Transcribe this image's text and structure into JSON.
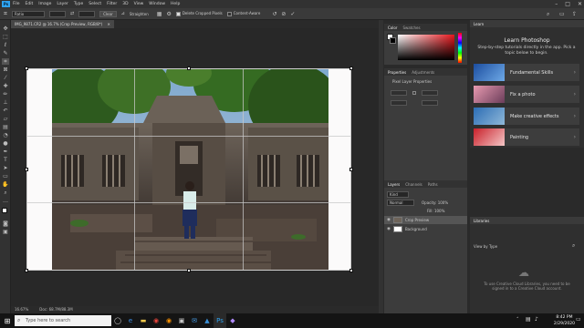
{
  "menubar": {
    "logo": "Ps",
    "items": [
      "File",
      "Edit",
      "Image",
      "Layer",
      "Type",
      "Select",
      "Filter",
      "3D",
      "View",
      "Window",
      "Help"
    ]
  },
  "options": {
    "ratio_value": "Ratio",
    "clear_label": "Clear",
    "straighten_label": "Straighten",
    "delete_cropped_label": "Delete Cropped Pixels",
    "content_aware_label": "Content-Aware"
  },
  "document": {
    "tab_title": "IMG_9871.CR2 @ 16.7% (Crop Preview, RGB/8*)",
    "zoom": "16.67%",
    "doc_size": "Doc: 68.7M/88.3M"
  },
  "color_panel": {
    "tabs": [
      "Color",
      "Swatches"
    ],
    "hue_color": "#e8171d"
  },
  "properties_panel": {
    "tabs": [
      "Properties",
      "Adjustments"
    ],
    "subtitle": "Pixel Layer Properties"
  },
  "layers_panel": {
    "tabs": [
      "Layers",
      "Channels",
      "Paths"
    ],
    "search_placeholder": "Kind",
    "blend_mode": "Normal",
    "opacity": "Opacity: 100%",
    "fill": "Fill: 100%",
    "layers": [
      {
        "name": "Crop Preview"
      },
      {
        "name": "Background"
      }
    ]
  },
  "learn_panel": {
    "tab": "Learn",
    "title": "Learn Photoshop",
    "description": "Step-by-step tutorials directly in the app. Pick a topic below to begin.",
    "cards": [
      {
        "label": "Fundamental Skills"
      },
      {
        "label": "Fix a photo"
      },
      {
        "label": "Make creative effects"
      },
      {
        "label": "Painting"
      }
    ]
  },
  "libraries_panel": {
    "tab": "Libraries",
    "view_label": "View by Type",
    "message": "To use Creative Cloud Libraries, you need to be signed in to a Creative Cloud account."
  },
  "taskbar": {
    "search_placeholder": "Type here to search",
    "time": "8:42 PM",
    "date": "2/29/2020"
  }
}
